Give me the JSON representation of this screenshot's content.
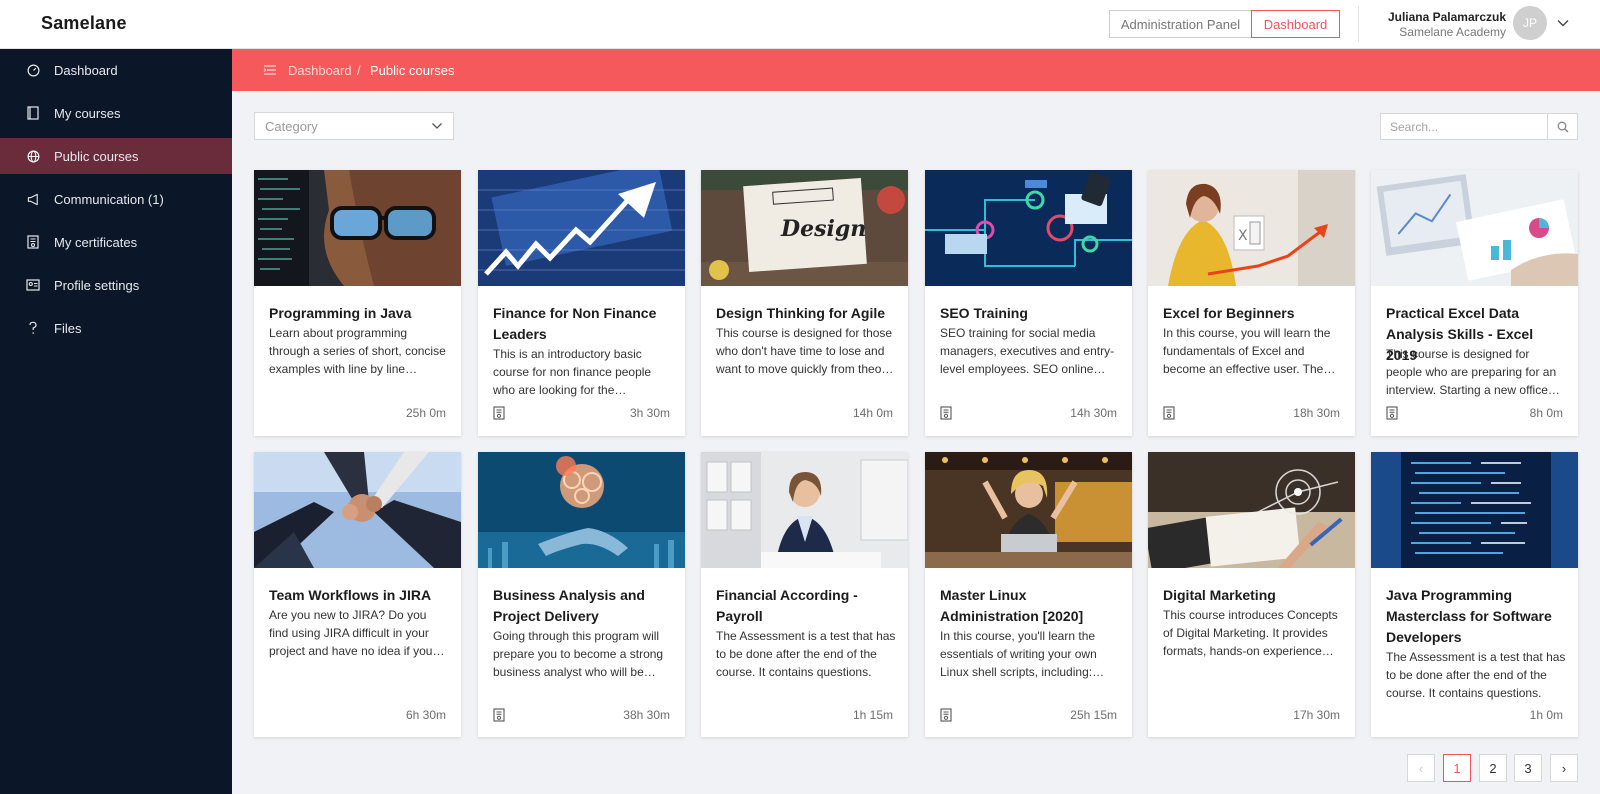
{
  "app": {
    "logo_text": "Samelane"
  },
  "header": {
    "admin_panel_label": "Administration Panel",
    "dashboard_label": "Dashboard",
    "user_name": "Juliana Palamarczuk",
    "user_org": "Samelane Academy",
    "user_initials": "JP",
    "accent_color": "#f0555a"
  },
  "sidebar": {
    "items": [
      {
        "label": "Dashboard",
        "icon": "dashboard-icon"
      },
      {
        "label": "My courses",
        "icon": "book-icon"
      },
      {
        "label": "Public courses",
        "icon": "globe-icon",
        "active": true
      },
      {
        "label": "Communication (1)",
        "icon": "megaphone-icon"
      },
      {
        "label": "My certificates",
        "icon": "certificate-icon"
      },
      {
        "label": "Profile settings",
        "icon": "id-card-icon"
      },
      {
        "label": "Files",
        "icon": "question-icon"
      }
    ]
  },
  "breadcrumb": {
    "home": "Dashboard",
    "separator": "/",
    "current": "Public courses"
  },
  "filters": {
    "category_placeholder": "Category",
    "search_placeholder": "Search..."
  },
  "courses": [
    {
      "title": "Programming in Java",
      "description": "Learn about programming through a series of short, concise examples with line by line explanations.",
      "duration": "25h 0m",
      "certificate": false
    },
    {
      "title": "Finance for Non Finance Leaders",
      "description": "This is an introductory basic course for non finance people who are looking for the fundamentals.",
      "duration": "3h 30m",
      "certificate": true
    },
    {
      "title": "Design Thinking for Agile",
      "description": "This course is designed for those who don't have time to lose and want to move quickly from theory to practice.",
      "duration": "14h 0m",
      "certificate": false
    },
    {
      "title": "SEO Training",
      "description": "SEO training for social media managers, executives and entry-level employees. SEO online marketing basics.",
      "duration": "14h 30m",
      "certificate": true
    },
    {
      "title": "Excel for Beginners",
      "description": "In this course, you will learn the fundamentals of Excel and become an effective user. The course covers essentials.",
      "duration": "18h 30m",
      "certificate": true
    },
    {
      "title": "Practical Excel Data Analysis Skills - Excel 2019",
      "description": "This course is designed for people who are preparing for an interview. Starting a new office job.",
      "duration": "8h 0m",
      "certificate": true
    },
    {
      "title": "Team Workflows in JIRA",
      "description": "Are you new to JIRA? Do you find using JIRA difficult in your project and have no idea if you are using it right?",
      "duration": "6h 30m",
      "certificate": false
    },
    {
      "title": "Business Analysis and Project Delivery",
      "description": "Going through this program will prepare you to become a strong business analyst who will be valued.",
      "duration": "38h 30m",
      "certificate": true
    },
    {
      "title": "Financial According - Payroll",
      "description": "The Assessment is a test that has to be done after the end of the course. It contains questions.",
      "duration": "1h 15m",
      "certificate": false
    },
    {
      "title": "Master Linux Administration [2020]",
      "description": "In this course, you'll learn the essentials of writing your own Linux shell scripts, including: variables.",
      "duration": "25h 15m",
      "certificate": true
    },
    {
      "title": "Digital Marketing",
      "description": "This course introduces Concepts of Digital Marketing. It provides formats, hands-on experience and tools.",
      "duration": "17h 30m",
      "certificate": false
    },
    {
      "title": "Java Programming Masterclass for Software Developers",
      "description": "The Assessment is a test that has to be done after the end of the course. It contains questions.",
      "duration": "1h 0m",
      "certificate": false
    }
  ],
  "pagination": {
    "pages": [
      "1",
      "2",
      "3"
    ],
    "current": "1",
    "prev": "‹",
    "next": "›"
  }
}
